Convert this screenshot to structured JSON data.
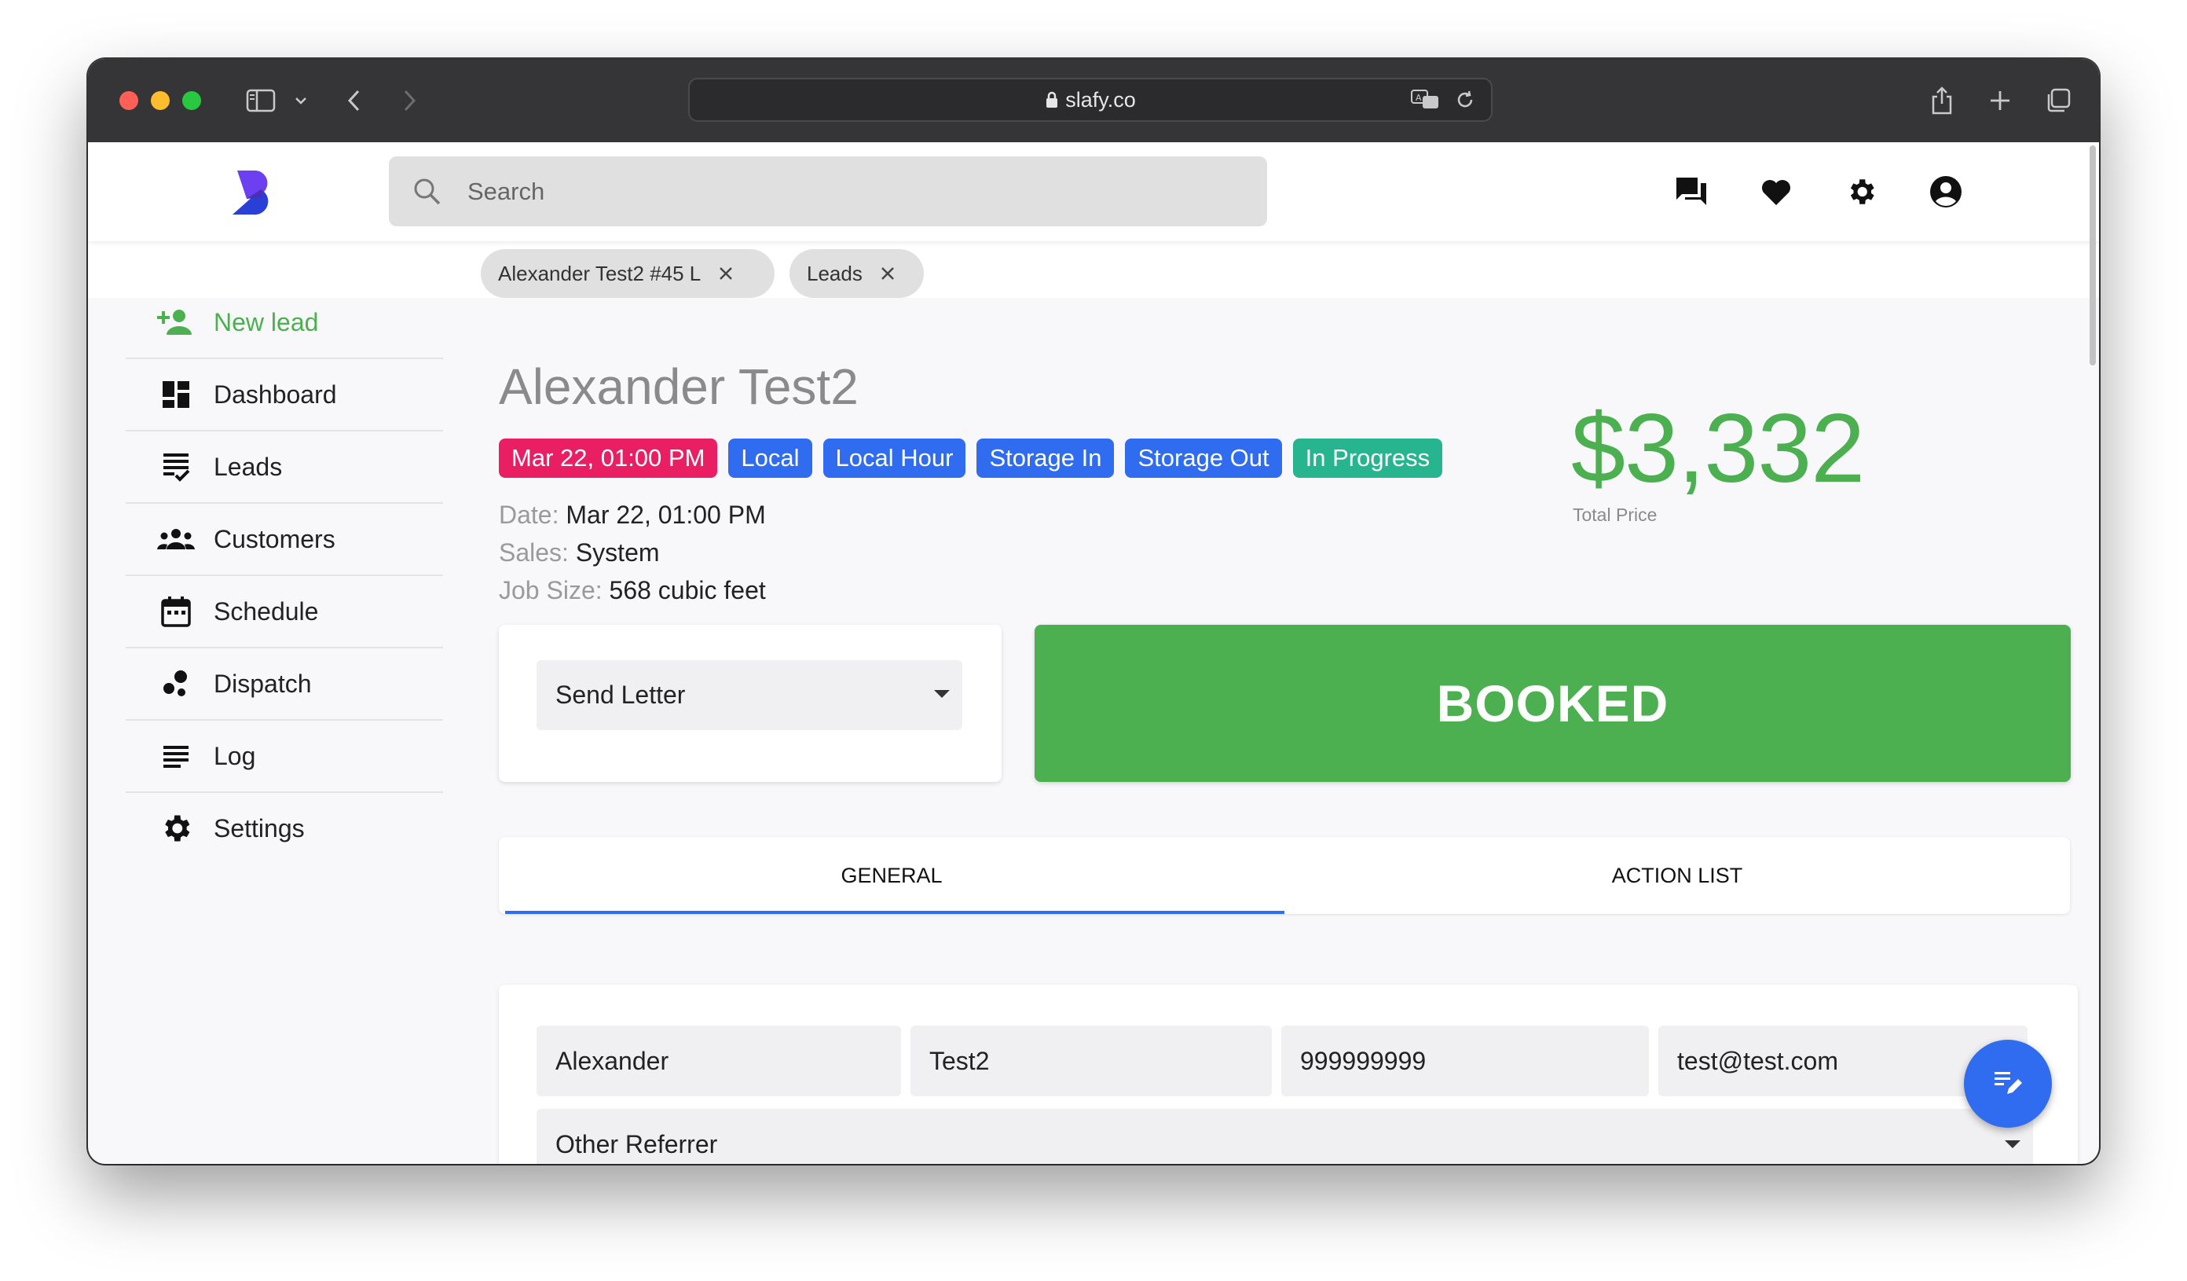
{
  "browser": {
    "url": "slafy.co"
  },
  "header": {
    "search_placeholder": "Search",
    "icons": [
      "chat-icon",
      "heart-icon",
      "gear-icon",
      "account-icon"
    ]
  },
  "sidebar": {
    "items": [
      {
        "label": "New lead",
        "icon": "person-add-icon"
      },
      {
        "label": "Dashboard",
        "icon": "dashboard-icon"
      },
      {
        "label": "Leads",
        "icon": "leads-list-icon"
      },
      {
        "label": "Customers",
        "icon": "people-icon"
      },
      {
        "label": "Schedule",
        "icon": "calendar-icon"
      },
      {
        "label": "Dispatch",
        "icon": "dispatch-icon"
      },
      {
        "label": "Log",
        "icon": "log-icon"
      },
      {
        "label": "Settings",
        "icon": "gear-icon"
      }
    ]
  },
  "open_tabs": [
    {
      "label": "Alexander Test2 #45 L"
    },
    {
      "label": "Leads"
    }
  ],
  "lead": {
    "name": "Alexander Test2",
    "badges": [
      {
        "label": "Mar 22, 01:00 PM",
        "color": "#e91e63"
      },
      {
        "label": "Local",
        "color": "#2f6cf0"
      },
      {
        "label": "Local Hour",
        "color": "#2f6cf0"
      },
      {
        "label": "Storage In",
        "color": "#2f6cf0"
      },
      {
        "label": "Storage Out",
        "color": "#2f6cf0"
      },
      {
        "label": "In Progress",
        "color": "#26b58f"
      }
    ],
    "date_label": "Date:",
    "date_value": "Mar 22, 01:00 PM",
    "sales_label": "Sales:",
    "sales_value": "System",
    "job_size_label": "Job Size:",
    "job_size_value": "568 cubic feet",
    "total_price": "$3,332",
    "total_price_label": "Total Price"
  },
  "actions": {
    "send_letter": "Send Letter",
    "status_button": "BOOKED"
  },
  "tabs": [
    {
      "label": "GENERAL",
      "active": true
    },
    {
      "label": "ACTION LIST",
      "active": false
    }
  ],
  "form": {
    "first_name": "Alexander",
    "last_name": "Test2",
    "phone": "999999999",
    "email": "test@test.com",
    "referrer": "Other Referrer"
  },
  "colors": {
    "accent_green": "#4caf50",
    "accent_blue": "#2f6cf0"
  }
}
